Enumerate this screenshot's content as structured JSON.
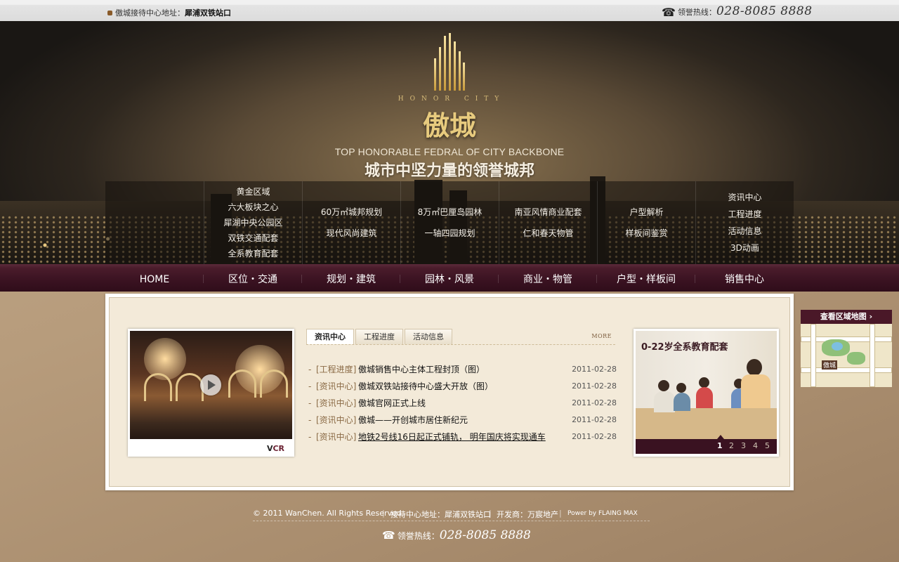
{
  "topbar": {
    "address_label": "傲城接待中心地址：",
    "address_value": "犀浦双铁站口",
    "hotline_label": "领誉热线：",
    "hotline_number": "028-8085 8888"
  },
  "hero": {
    "brand_en": "HONOR CITY",
    "brand_cn": "傲城",
    "slogan_en": "TOP HONORABLE FEDRAL OF CITY BACKBONE",
    "slogan_cn": "城市中坚力量的领誉城邦"
  },
  "submenu": [
    {
      "items": []
    },
    {
      "items": [
        "黄金区域",
        "六大板块之心",
        "犀湖中央公园区",
        "双铁交通配套",
        "全系教育配套"
      ]
    },
    {
      "items": [
        "60万㎡城邦规划",
        "现代风尚建筑"
      ]
    },
    {
      "items": [
        "8万㎡巴厘岛园林",
        "一轴四园规划"
      ]
    },
    {
      "items": [
        "南亚风情商业配套",
        "仁和春天物管"
      ]
    },
    {
      "items": [
        "户型解析",
        "样板间鉴赏"
      ]
    },
    {
      "items": [
        "资讯中心",
        "工程进度",
        "活动信息",
        "3D动画"
      ]
    }
  ],
  "nav": [
    "HOME",
    "区位・交通",
    "规划・建筑",
    "园林・风景",
    "商业・物管",
    "户型・样板间",
    "销售中心"
  ],
  "video": {
    "label_v": "V",
    "label_cr": "CR"
  },
  "news": {
    "tabs": [
      "资讯中心",
      "工程进度",
      "活动信息"
    ],
    "more": "MORE",
    "items": [
      {
        "category": "[工程进度]",
        "title": "傲城销售中心主体工程封顶（图）",
        "date": "2011-02-28"
      },
      {
        "category": "[资讯中心]",
        "title": "傲城双铁站接待中心盛大开放（图）",
        "date": "2011-02-28"
      },
      {
        "category": "[资讯中心]",
        "title": "傲城官网正式上线",
        "date": "2011-02-28"
      },
      {
        "category": "[资讯中心]",
        "title": "傲城——开创城市居住新纪元",
        "date": "2011-02-28"
      },
      {
        "category": "[资讯中心]",
        "title": "地铁2号线16日起正式铺轨， 明年国庆将实现通车",
        "date": "2011-02-28"
      }
    ]
  },
  "edu": {
    "title": "0-22岁全系教育配套",
    "pages": [
      "1",
      "2",
      "3",
      "4",
      "5"
    ]
  },
  "map": {
    "title": "查看区域地图",
    "label": "傲城"
  },
  "footer": {
    "copyright": "© 2011 WanChen. All Rights Reserved.",
    "reception": "接待中心地址：犀浦双铁站口",
    "developer": "开发商：万宸地产",
    "powered": "Power by FLAING MAX",
    "hotline_label": "领誉热线：",
    "hotline_number": "028-8085 8888"
  },
  "colors": {
    "nav_bg": "#3a1221",
    "content_bg": "#f3ead9",
    "gold": "#e8cb7e",
    "category": "#8a6a45"
  }
}
